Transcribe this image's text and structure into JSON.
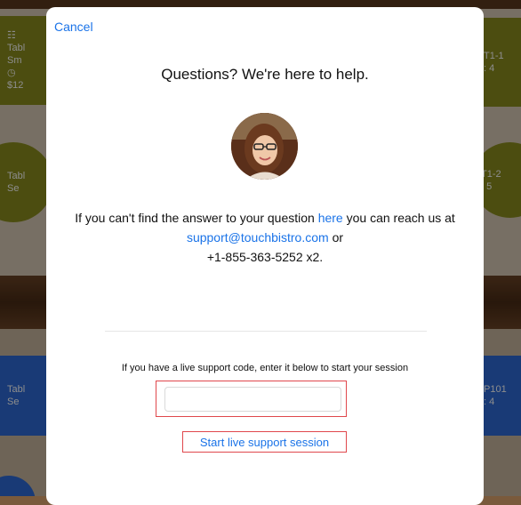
{
  "background_tables": {
    "left_1": {
      "line1": "Tabl",
      "line2": "Sm",
      "line3": "$12"
    },
    "left_2": {
      "line1": "Tabl",
      "line2": "Se"
    },
    "left_3": {
      "line1": "Tabl",
      "line2": "Se"
    },
    "right_1": {
      "line1": "T1-1",
      "line2": ": 4"
    },
    "right_2": {
      "line1": "T1-2",
      "line2": ": 5"
    },
    "right_3": {
      "line1": "P101",
      "line2": ": 4"
    }
  },
  "modal": {
    "cancel_label": "Cancel",
    "title": "Questions? We're here to help.",
    "help": {
      "part1": "If you can't find the answer to your question ",
      "here_link": "here",
      "part2": " you can reach us at ",
      "email_link": "support@touchbistro.com",
      "part3": " or",
      "phone": "+1-855-363-5252 x2."
    },
    "code_label": "If you have a live support code, enter it below to start your session",
    "code_input_value": "",
    "code_input_placeholder": "",
    "start_button_label": "Start live support session"
  },
  "colors": {
    "link": "#1a73e8",
    "highlight_border": "#e0474c",
    "olive_table": "#8a8d1e",
    "blue_table": "#2e6bd8"
  },
  "icons": [
    "clock-icon",
    "guest-icon"
  ]
}
